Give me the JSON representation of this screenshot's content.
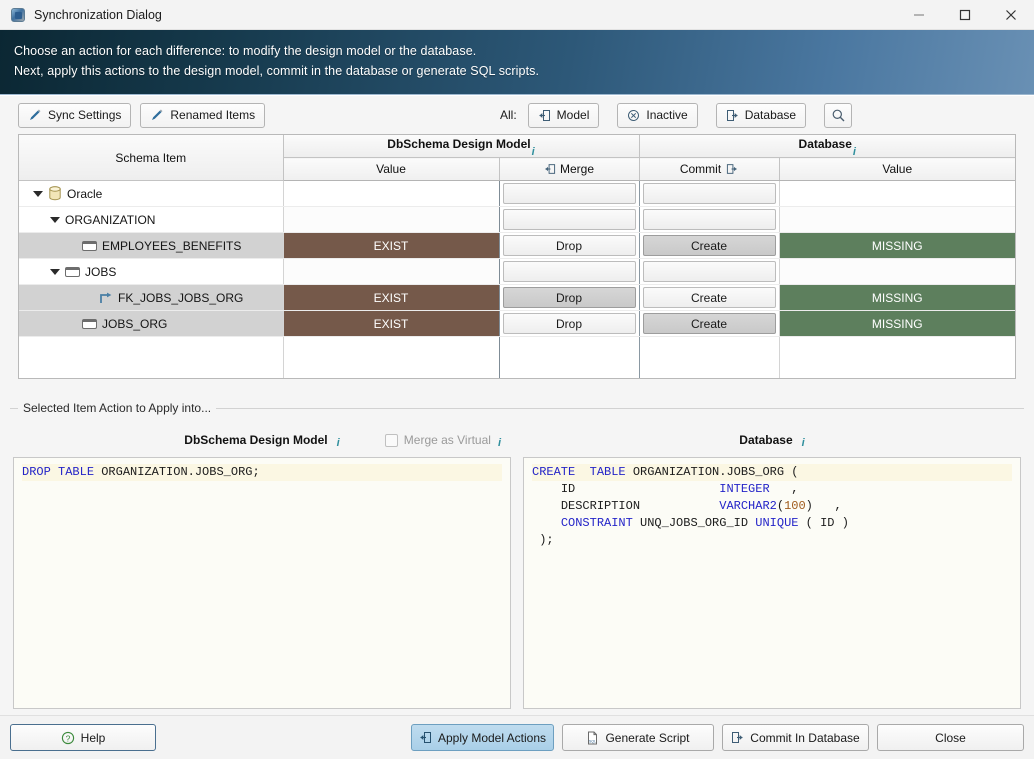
{
  "window": {
    "title": "Synchronization Dialog",
    "icon": "dbschema-cube-icon",
    "controls": {
      "minimize": "—",
      "maximize": "□",
      "close": "✕"
    }
  },
  "banner": {
    "line1": "Choose an action for each difference: to modify the design model or the database.",
    "line2": "Next, apply this actions to the design model, commit in the database or generate SQL scripts."
  },
  "toolbar": {
    "sync_settings": "Sync Settings",
    "renamed_items": "Renamed Items",
    "all_label": "All:",
    "model": "Model",
    "inactive": "Inactive",
    "database": "Database",
    "search_icon": "search-icon"
  },
  "table": {
    "headers": {
      "schema_item": "Schema Item",
      "design_model": "DbSchema Design Model",
      "database": "Database",
      "value_model": "Value",
      "merge": "Merge",
      "commit": "Commit",
      "value_db": "Value"
    },
    "rows": [
      {
        "name": "Oracle",
        "icon": "database-icon",
        "indent": 0,
        "twisty": true,
        "model_value": "",
        "merge": "",
        "commit": "",
        "db_value": "",
        "selected": false,
        "merge_pressed": false,
        "commit_pressed": false,
        "model_state": "none",
        "db_state": "none"
      },
      {
        "name": "ORGANIZATION",
        "icon": "none",
        "indent": 1,
        "twisty": true,
        "model_value": "",
        "merge": "",
        "commit": "",
        "db_value": "",
        "selected": false,
        "merge_pressed": false,
        "commit_pressed": false,
        "model_state": "none",
        "db_state": "none"
      },
      {
        "name": "EMPLOYEES_BENEFITS",
        "icon": "table-icon",
        "indent": 2,
        "twisty": false,
        "model_value": "EXIST",
        "merge": "Drop",
        "commit": "Create",
        "db_value": "MISSING",
        "selected": true,
        "merge_pressed": false,
        "commit_pressed": true,
        "model_state": "exist",
        "db_state": "missing"
      },
      {
        "name": "JOBS",
        "icon": "table-icon",
        "indent": 1,
        "twisty": true,
        "model_value": "",
        "merge": "",
        "commit": "",
        "db_value": "",
        "selected": false,
        "merge_pressed": false,
        "commit_pressed": false,
        "model_state": "none",
        "db_state": "none"
      },
      {
        "name": "FK_JOBS_JOBS_ORG",
        "icon": "foreign-key-icon",
        "indent": 3,
        "twisty": false,
        "model_value": "EXIST",
        "merge": "Drop",
        "commit": "Create",
        "db_value": "MISSING",
        "selected": true,
        "merge_pressed": true,
        "commit_pressed": false,
        "model_state": "exist",
        "db_state": "missing"
      },
      {
        "name": "JOBS_ORG",
        "icon": "table-icon",
        "indent": 2,
        "twisty": false,
        "model_value": "EXIST",
        "merge": "Drop",
        "commit": "Create",
        "db_value": "MISSING",
        "selected": true,
        "merge_pressed": false,
        "commit_pressed": true,
        "model_state": "exist",
        "db_state": "missing"
      }
    ]
  },
  "detail": {
    "group_title": "Selected Item Action to Apply into...",
    "model_pane_title": "DbSchema Design Model",
    "db_pane_title": "Database",
    "merge_as_virtual": "Merge as Virtual",
    "merge_as_virtual_checked": false,
    "model_sql_lines": [
      "DROP TABLE ORGANIZATION.JOBS_ORG;"
    ],
    "db_sql_lines": [
      "CREATE  TABLE ORGANIZATION.JOBS_ORG (",
      "    ID                    INTEGER   ,",
      "    DESCRIPTION           VARCHAR2(100)   ,",
      "    CONSTRAINT UNQ_JOBS_ORG_ID UNIQUE ( ID )",
      " );"
    ]
  },
  "footer": {
    "help": "Help",
    "apply": "Apply Model Actions",
    "generate": "Generate Script",
    "commit": "Commit In Database",
    "close": "Close"
  },
  "colors": {
    "exist_bg": "#75594a",
    "missing_bg": "#5d7f5d",
    "selected_row": "#d2d2d2",
    "accent_blue": "#a9cfe8",
    "info_teal": "#2f8f9d"
  }
}
